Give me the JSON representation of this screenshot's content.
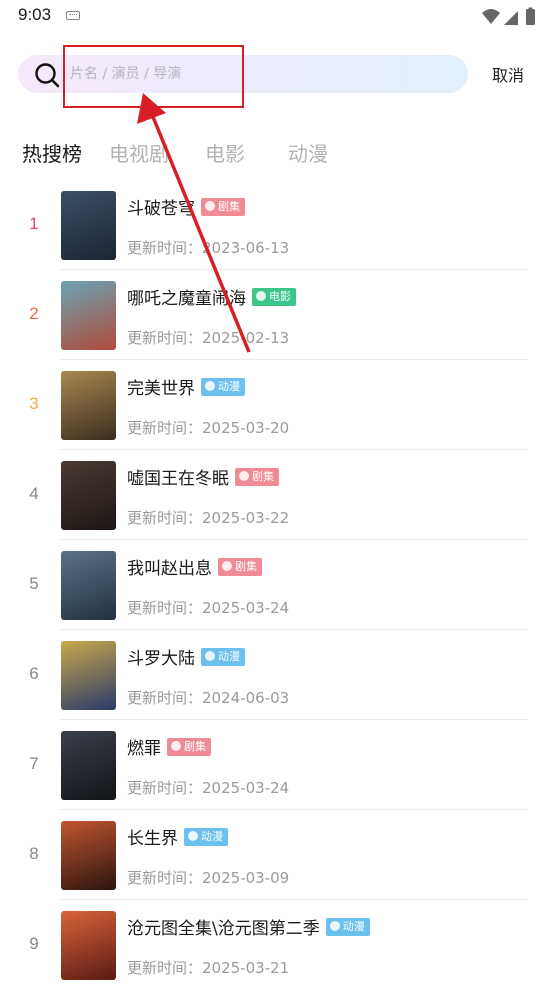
{
  "status_bar": {
    "time": "9:03"
  },
  "search": {
    "placeholder": "片名 / 演员 / 导演",
    "cancel_label": "取消"
  },
  "tabs": [
    {
      "label": "热搜榜",
      "active": true
    },
    {
      "label": "电视剧",
      "active": false
    },
    {
      "label": "电影",
      "active": false
    },
    {
      "label": "动漫",
      "active": false
    }
  ],
  "date_prefix": "更新时间：",
  "items": [
    {
      "rank": "1",
      "rank_color": "#e2387f",
      "title": "斗破苍穹",
      "tag": "剧集",
      "tag_type": "drama",
      "date": "2023-06-13",
      "poster_colors": [
        "#3d4e63",
        "#1c2634"
      ]
    },
    {
      "rank": "2",
      "rank_color": "#ef6a4b",
      "title": "哪吒之魔童闹海",
      "tag": "电影",
      "tag_type": "movie",
      "date": "2025-02-13",
      "poster_colors": [
        "#6aa3b4",
        "#b04b3a"
      ]
    },
    {
      "rank": "3",
      "rank_color": "#f2a94a",
      "title": "完美世界",
      "tag": "动漫",
      "tag_type": "anime",
      "date": "2025-03-20",
      "poster_colors": [
        "#a8884e",
        "#3a2e20"
      ]
    },
    {
      "rank": "4",
      "rank_color": "#888888",
      "title": "嘘国王在冬眠",
      "tag": "剧集",
      "tag_type": "drama",
      "date": "2025-03-22",
      "poster_colors": [
        "#4a3a33",
        "#1d1614"
      ]
    },
    {
      "rank": "5",
      "rank_color": "#888888",
      "title": "我叫赵出息",
      "tag": "剧集",
      "tag_type": "drama",
      "date": "2025-03-24",
      "poster_colors": [
        "#5d7285",
        "#223040"
      ]
    },
    {
      "rank": "6",
      "rank_color": "#888888",
      "title": "斗罗大陆",
      "tag": "动漫",
      "tag_type": "anime",
      "date": "2024-06-03",
      "poster_colors": [
        "#c9a84a",
        "#2a3a6a"
      ]
    },
    {
      "rank": "7",
      "rank_color": "#888888",
      "title": "燃罪",
      "tag": "剧集",
      "tag_type": "drama",
      "date": "2025-03-24",
      "poster_colors": [
        "#3a3f4a",
        "#121418"
      ]
    },
    {
      "rank": "8",
      "rank_color": "#888888",
      "title": "长生界",
      "tag": "动漫",
      "tag_type": "anime",
      "date": "2025-03-09",
      "poster_colors": [
        "#c2562e",
        "#2a1410"
      ]
    },
    {
      "rank": "9",
      "rank_color": "#888888",
      "title": "沧元图全集\\沧元图第二季",
      "tag": "动漫",
      "tag_type": "anime",
      "date": "2025-03-21",
      "poster_colors": [
        "#d8643a",
        "#5a1a12"
      ]
    }
  ]
}
